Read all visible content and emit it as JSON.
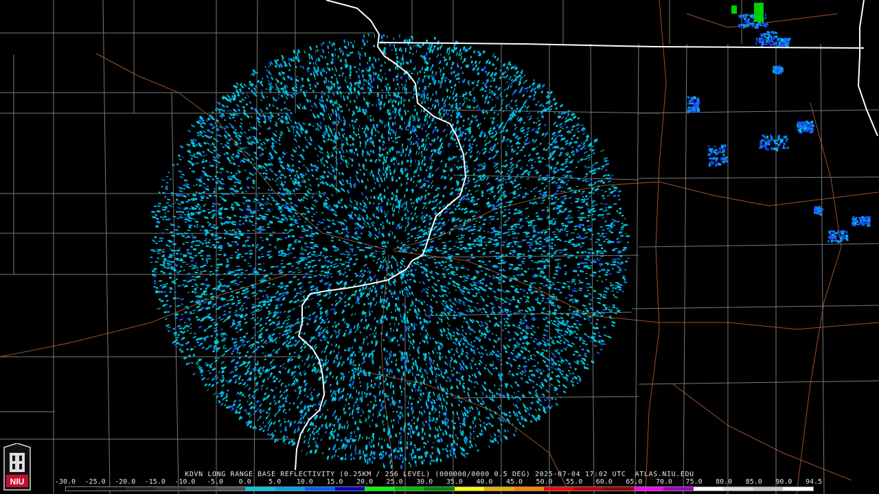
{
  "caption": "KDVN LONG RANGE BASE REFLECTIVITY (0.25KM / 256 LEVEL) (000000/0000 0.5 DEG) 2025-07-04 17:02 UTC  ATLAS.NIU.EDU",
  "logo": {
    "text": "NIU",
    "color": "#c8102e"
  },
  "legend": {
    "ticks": [
      "-30.0",
      "-25.0",
      "-20.0",
      "-15.0",
      "-10.0",
      "-5.0",
      "0.0",
      "5.0",
      "10.0",
      "15.0",
      "20.0",
      "25.0",
      "30.0",
      "35.0",
      "40.0",
      "45.0",
      "50.0",
      "55.0",
      "60.0",
      "65.0",
      "70.0",
      "75.0",
      "80.0",
      "85.0",
      "90.0",
      "94.5"
    ],
    "colors": [
      "#000000",
      "#101010",
      "#202020",
      "#303030",
      "#404040",
      "#505050",
      "#00c8e0",
      "#00a0f0",
      "#0060ff",
      "#0000c8",
      "#00ff00",
      "#00c000",
      "#008800",
      "#ffff00",
      "#e8b000",
      "#ff8000",
      "#ff0000",
      "#c00000",
      "#900000",
      "#ff00ff",
      "#a000c0",
      "#ffffff",
      "#e0e0e0",
      "#c8c8c8",
      "#ffffff"
    ]
  },
  "map": {
    "radar_site": "KDVN",
    "colors": {
      "state_border": "#ffffff",
      "county_line": "#7a7a7a",
      "road": "#a0522d",
      "echo_light": "#00c8e0",
      "echo_mid": "#0a8cf0",
      "echo_strong": "#1e4bff",
      "echo_green": "#00d000"
    }
  }
}
